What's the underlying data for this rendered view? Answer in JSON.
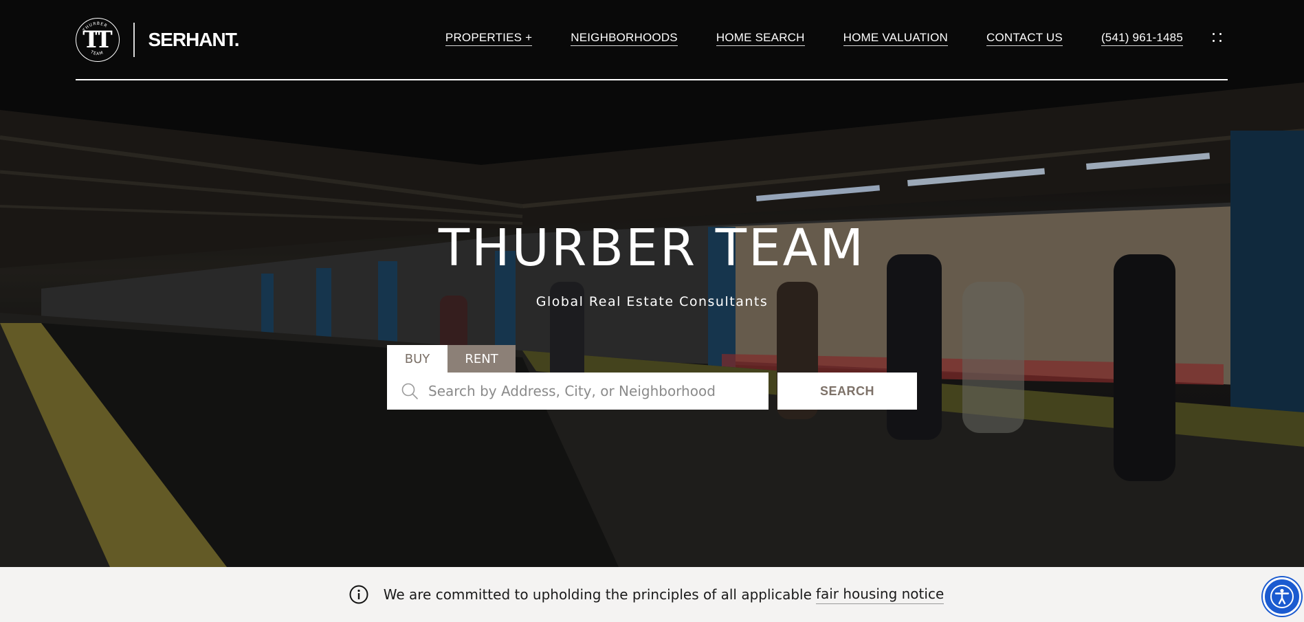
{
  "header": {
    "logo": {
      "monogram": "TT",
      "ring_text_top": "THURBER",
      "ring_text_bottom": "TEAM",
      "brand": "SERHANT."
    },
    "nav": [
      {
        "label": "PROPERTIES +"
      },
      {
        "label": "NEIGHBORHOODS"
      },
      {
        "label": "HOME SEARCH"
      },
      {
        "label": "HOME VALUATION"
      },
      {
        "label": "CONTACT US"
      },
      {
        "label": "(541) 961-1485"
      }
    ],
    "menu_icon": "grid-dots-icon"
  },
  "hero": {
    "title": "THURBER TEAM",
    "subtitle": "Global Real Estate Consultants"
  },
  "search": {
    "tabs": [
      {
        "label": "BUY",
        "active": true
      },
      {
        "label": "RENT",
        "active": false
      }
    ],
    "placeholder": "Search by Address, City, or Neighborhood",
    "value": "",
    "button_label": "SEARCH",
    "icon": "search-icon"
  },
  "notice": {
    "icon": "info-icon",
    "text": "We are committed to upholding the principles of all applicable",
    "link_label": "fair housing notice"
  },
  "accessibility": {
    "icon": "accessibility-icon",
    "color": "#1b5bd0"
  },
  "colors": {
    "tab_rent_bg": "#8c8077",
    "search_button_text": "#7d7168",
    "notice_bg": "#f4f3f2"
  }
}
